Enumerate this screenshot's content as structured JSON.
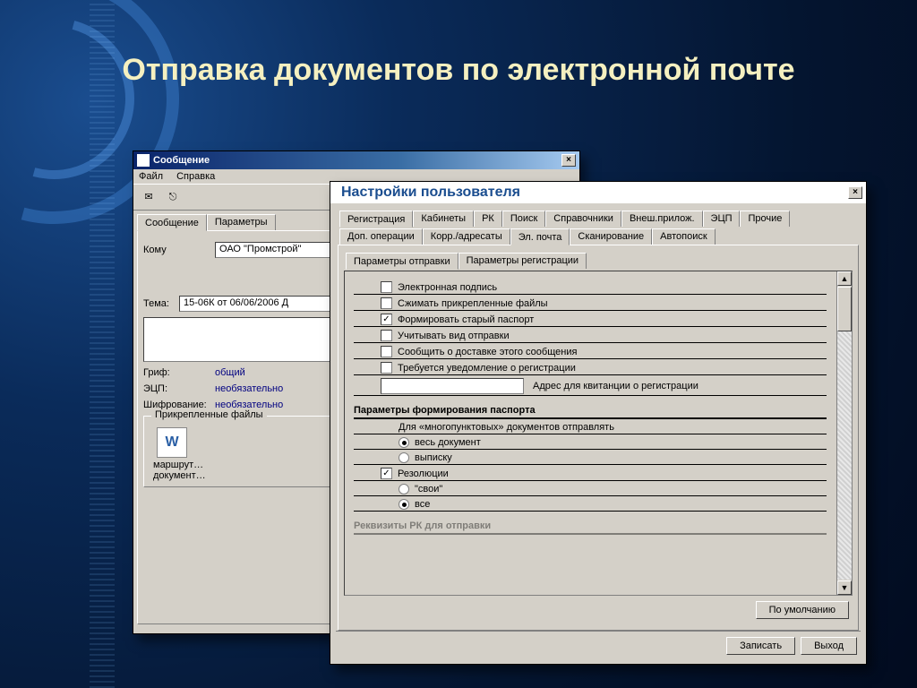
{
  "slide_title": "Отправка документов по электронной почте",
  "back_window": {
    "title": "Сообщение",
    "menu": [
      "Файл",
      "Справка"
    ],
    "tabs": [
      "Сообщение",
      "Параметры"
    ],
    "to_label": "Кому",
    "to_value": "ОАО \"Промстрой\"",
    "subject_label": "Тема:",
    "subject_value": "15-06К от 06/06/2006 Д",
    "grif_label": "Гриф:",
    "grif_value": "общий",
    "ecp_label": "ЭЦП:",
    "ecp_value": "необязательно",
    "encrypt_label": "Шифрование:",
    "encrypt_value": "необязательно",
    "attach_group": "Прикрепленные файлы",
    "attach1": "маршрут…",
    "attach2": "документ…"
  },
  "front_window": {
    "title": "Настройки пользователя",
    "tabs_row1": [
      "Регистрация",
      "Кабинеты",
      "РК",
      "Поиск",
      "Справочники",
      "Внеш.прилож.",
      "ЭЦП",
      "Прочие"
    ],
    "tabs_row2": [
      "Доп. операции",
      "Корр./адресаты",
      "Эл. почта",
      "Сканирование",
      "Автопоиск"
    ],
    "active_tab2": "Эл. почта",
    "subtabs": [
      "Параметры отправки",
      "Параметры регистрации"
    ],
    "active_subtab": "Параметры отправки",
    "checks": [
      {
        "label": "Электронная подпись",
        "checked": false
      },
      {
        "label": "Сжимать прикрепленные файлы",
        "checked": false
      },
      {
        "label": "Формировать старый паспорт",
        "checked": true
      },
      {
        "label": "Учитывать вид отправки",
        "checked": false
      },
      {
        "label": "Сообщить о доставке этого сообщения",
        "checked": false
      },
      {
        "label": "Требуется уведомление о регистрации",
        "checked": false
      }
    ],
    "addr_label": "Адрес для квитанции о регистрации",
    "section_title": "Параметры формирования паспорта",
    "multi_label": "Для «многопунктовых» документов отправлять",
    "radios1": [
      {
        "label": "весь документ",
        "selected": true
      },
      {
        "label": "выписку",
        "selected": false
      }
    ],
    "resolutions_check": {
      "label": "Резолюции",
      "checked": true
    },
    "radios2": [
      {
        "label": "\"свои\"",
        "selected": false
      },
      {
        "label": "все",
        "selected": true
      }
    ],
    "truncated_row": "Реквизиты РК для отправки",
    "btn_default": "По умолчанию",
    "btn_save": "Записать",
    "btn_exit": "Выход"
  }
}
